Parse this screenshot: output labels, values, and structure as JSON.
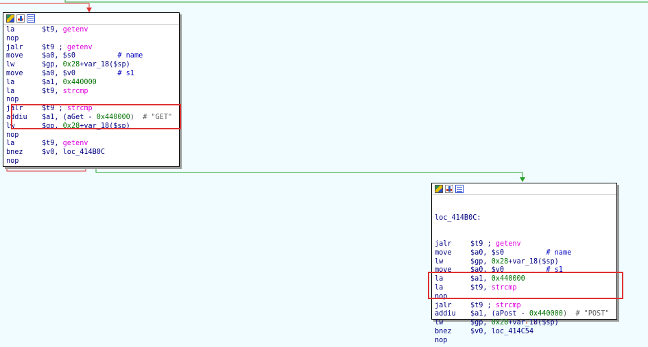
{
  "block1": {
    "lines": [
      {
        "mn": "la",
        "a": "$t9, ",
        "b": "getenv",
        "bc": "pink",
        "c": ""
      },
      {
        "mn": "nop",
        "a": "",
        "b": "",
        "bc": "",
        "c": ""
      },
      {
        "mn": "jalr",
        "a": "$t9 ; ",
        "b": "getenv",
        "bc": "pink",
        "c": ""
      },
      {
        "mn": "move",
        "a": "$a0, $s0          ",
        "b": "# name",
        "bc": "cmt",
        "c": ""
      },
      {
        "mn": "lw",
        "a": "$gp, ",
        "b": "0x28",
        "bc": "green",
        "c": "+var_18($sp)"
      },
      {
        "mn": "move",
        "a": "$a0, $v0          ",
        "b": "# s1",
        "bc": "cmt",
        "c": ""
      },
      {
        "mn": "la",
        "a": "$a1, ",
        "b": "0x440000",
        "bc": "green",
        "c": ""
      },
      {
        "mn": "la",
        "a": "$t9, ",
        "b": "strcmp",
        "bc": "pink",
        "c": ""
      },
      {
        "mn": "nop",
        "a": "",
        "b": "",
        "bc": "",
        "c": ""
      },
      {
        "mn": "jalr",
        "a": "$t9 ; ",
        "b": "strcmp",
        "bc": "pink",
        "c": ""
      },
      {
        "mn": "addiu",
        "a": "$a1, (aGet - ",
        "b": "0x440000",
        "bc": "green",
        "c": ")  # \"GET\""
      },
      {
        "mn": "lw",
        "a": "$gp, ",
        "b": "0x28",
        "bc": "green",
        "c": "+var_18($sp)"
      },
      {
        "mn": "nop",
        "a": "",
        "b": "",
        "bc": "",
        "c": ""
      },
      {
        "mn": "la",
        "a": "$t9, ",
        "b": "getenv",
        "bc": "pink",
        "c": ""
      },
      {
        "mn": "bnez",
        "a": "$v0, loc_414B0C",
        "b": "",
        "bc": "",
        "c": ""
      },
      {
        "mn": "nop",
        "a": "",
        "b": "",
        "bc": "",
        "c": ""
      }
    ]
  },
  "block2": {
    "label": "loc_414B0C:",
    "lines": [
      {
        "mn": "jalr",
        "a": "$t9 ; ",
        "b": "getenv",
        "bc": "pink",
        "c": ""
      },
      {
        "mn": "move",
        "a": "$a0, $s0          ",
        "b": "# name",
        "bc": "cmt",
        "c": ""
      },
      {
        "mn": "lw",
        "a": "$gp, ",
        "b": "0x28",
        "bc": "green",
        "c": "+var_18($sp)"
      },
      {
        "mn": "move",
        "a": "$a0, $v0          ",
        "b": "# s1",
        "bc": "cmt",
        "c": ""
      },
      {
        "mn": "la",
        "a": "$a1, ",
        "b": "0x440000",
        "bc": "green",
        "c": ""
      },
      {
        "mn": "la",
        "a": "$t9, ",
        "b": "strcmp",
        "bc": "pink",
        "c": ""
      },
      {
        "mn": "nop",
        "a": "",
        "b": "",
        "bc": "",
        "c": ""
      },
      {
        "mn": "jalr",
        "a": "$t9 ; ",
        "b": "strcmp",
        "bc": "pink",
        "c": ""
      },
      {
        "mn": "addiu",
        "a": "$a1, (aPost - ",
        "b": "0x440000",
        "bc": "green",
        "c": ")  # \"POST\""
      },
      {
        "mn": "lw",
        "a": "$gp, ",
        "b": "0x28",
        "bc": "green",
        "c": "+var_18($sp)"
      },
      {
        "mn": "bnez",
        "a": "$v0, loc_414C54",
        "b": "",
        "bc": "",
        "c": ""
      },
      {
        "mn": "nop",
        "a": "",
        "b": "",
        "bc": "",
        "c": ""
      }
    ]
  },
  "colors": {
    "background": "#f0fcff",
    "edge_true": "#2aa02a",
    "edge_false": "#e03030",
    "highlight": "#e03030"
  },
  "icons": [
    "color-palette-icon",
    "graph-view-icon",
    "text-view-icon"
  ]
}
